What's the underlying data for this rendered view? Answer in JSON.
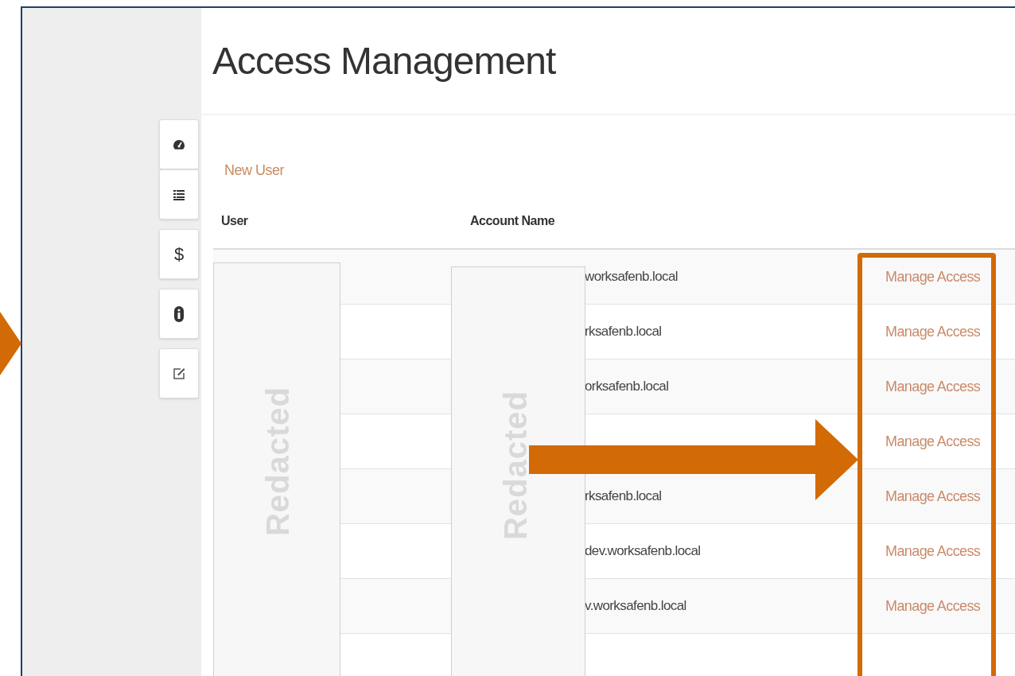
{
  "page": {
    "title": "Access Management"
  },
  "sidebar": {
    "items": [
      {
        "kind": "dashboard"
      },
      {
        "kind": "list"
      },
      {
        "kind": "glyph",
        "glyph": "$"
      },
      {
        "kind": "info"
      },
      {
        "kind": "edit"
      }
    ]
  },
  "new_user_link": "New User",
  "table": {
    "columns": [
      "User",
      "Account Name"
    ],
    "rows": [
      {
        "account": "worksafenb.local",
        "action": "Manage Access"
      },
      {
        "account": "rksafenb.local",
        "action": "Manage Access"
      },
      {
        "account": "orksafenb.local",
        "action": "Manage Access"
      },
      {
        "action": "Manage Access"
      },
      {
        "account": "rksafenb.local",
        "action": "Manage Access"
      },
      {
        "account": "dev.worksafenb.local",
        "action": "Manage Access"
      },
      {
        "account": "v.worksafenb.local",
        "action": "Manage Access"
      }
    ]
  },
  "annotations": {
    "redactions": [
      {
        "label": "Redacted"
      },
      {
        "label": "Redacted"
      }
    ]
  }
}
